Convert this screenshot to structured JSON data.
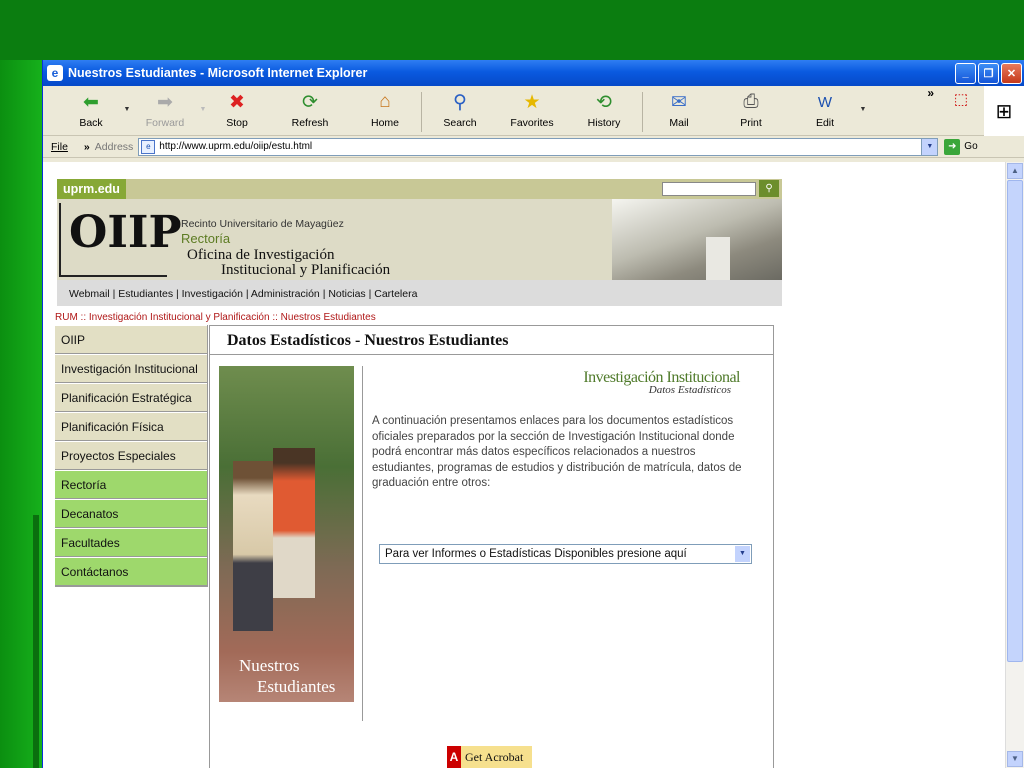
{
  "window": {
    "title": "Nuestros Estudiantes - Microsoft Internet Explorer"
  },
  "toolbar": {
    "back": "Back",
    "forward": "Forward",
    "stop": "Stop",
    "refresh": "Refresh",
    "home": "Home",
    "search": "Search",
    "favorites": "Favorites",
    "history": "History",
    "mail": "Mail",
    "print": "Print",
    "edit": "Edit"
  },
  "address_bar": {
    "file_menu": "File",
    "label": "Address",
    "url": "http://www.uprm.edu/oiip/estu.html",
    "go": "Go"
  },
  "site": {
    "logo": "uprm.edu",
    "oiip_logo": "OIIP",
    "banner_line1": "Recinto Universitario de Mayagüez",
    "banner_line2": "Rectoría",
    "banner_line3": "Oficina de Investigación",
    "banner_line4": "Institucional y Planificación",
    "nav": "Webmail | Estudiantes | Investigación | Administración | Noticias | Cartelera",
    "breadcrumb": "RUM :: Investigación Institucional y Planificación :: Nuestros Estudiantes"
  },
  "left_nav": [
    {
      "label": "OIIP",
      "color": "#e2dfc4"
    },
    {
      "label": "Investigación Institucional",
      "color": "#e2dfc4"
    },
    {
      "label": "Planificación Estratégica",
      "color": "#e2dfc4"
    },
    {
      "label": "Planificación Física",
      "color": "#e2dfc4"
    },
    {
      "label": "Proyectos Especiales",
      "color": "#e2dfc4"
    },
    {
      "label": "Rectoría",
      "color": "#9ed86c"
    },
    {
      "label": "Decanatos",
      "color": "#9ed86c"
    },
    {
      "label": "Facultades",
      "color": "#9ed86c"
    },
    {
      "label": "Contáctanos",
      "color": "#9ed86c"
    }
  ],
  "main": {
    "title": "Datos Estadísticos - Nuestros Estudiantes",
    "photo_caption_1": "Nuestros",
    "photo_caption_2": "Estudiantes",
    "section_heading": "Investigación Institucional",
    "section_sub": "Datos Estadísticos",
    "paragraph": "A continuación presentamos enlaces para los documentos estadísticos oficiales preparados por la sección de Investigación Institucional donde podrá encontrar más datos específicos relacionados a nuestros estudiantes, programas de estudios y distribución de matrícula, datos de graduación entre otros:",
    "select_value": "Para ver Informes o Estadísticas Disponibles presione aquí",
    "acrobat_badge": "Get Acrobat"
  },
  "colors": {
    "desktop": "#0d8a12",
    "titlebar": "#0a5ae0",
    "nav_beige": "#e2dfc4",
    "nav_green": "#9ed86c"
  }
}
